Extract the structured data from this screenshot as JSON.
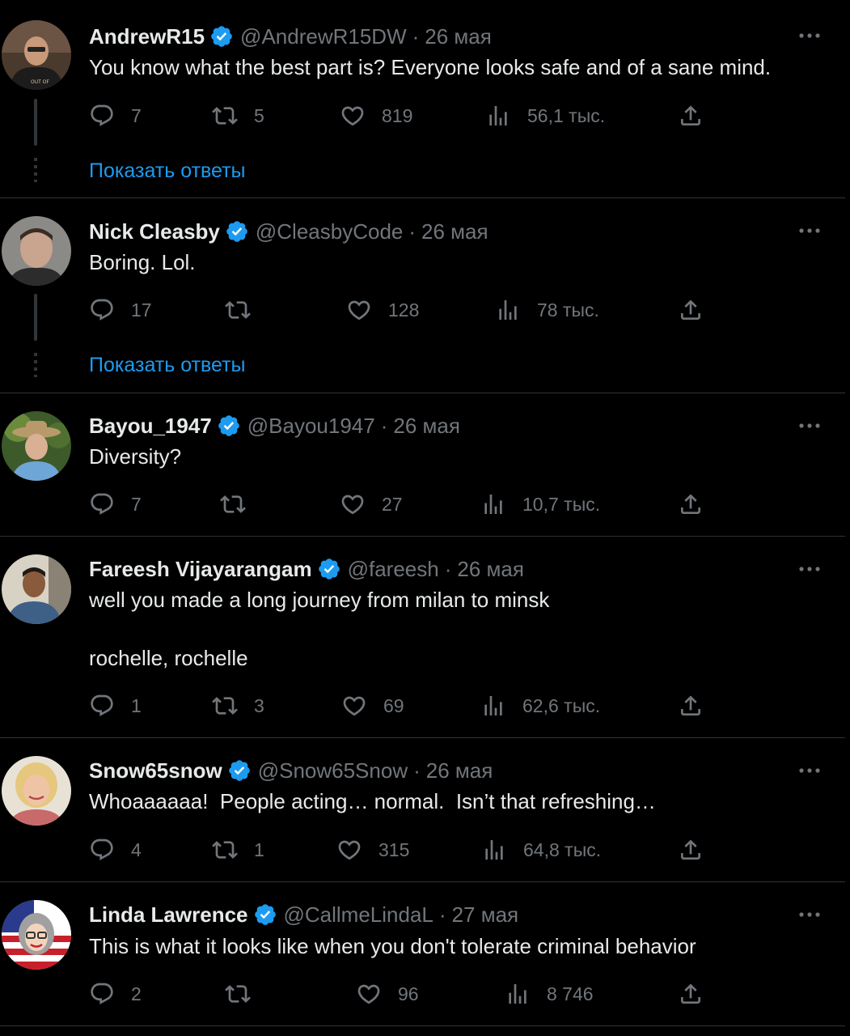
{
  "colors": {
    "background": "#000000",
    "text": "#e7e9ea",
    "secondary": "#71767b",
    "accent": "#1d9bf0",
    "divider": "#2f3336"
  },
  "icons": {
    "reply": "reply-icon",
    "retweet": "retweet-icon",
    "like": "heart-icon",
    "views": "views-chart-icon",
    "share": "share-icon",
    "more": "more-icon",
    "verified": "verified-badge-icon"
  },
  "tweets": [
    {
      "name": "AndrewR15",
      "handle": "@AndrewR15DW",
      "separator": "·",
      "date": "26 мая",
      "text": [
        "You know what the best part is? Everyone looks safe and of a sane mind."
      ],
      "replies": "7",
      "retweets": "5",
      "likes": "819",
      "views": "56,1 тыс.",
      "show_replies": "Показать ответы"
    },
    {
      "name": "Nick Cleasby",
      "handle": "@CleasbyCode",
      "separator": "·",
      "date": "26 мая",
      "text": [
        "Boring. Lol."
      ],
      "replies": "17",
      "retweets": "",
      "likes": "128",
      "views": "78 тыс.",
      "show_replies": "Показать ответы"
    },
    {
      "name": "Bayou_1947",
      "handle": "@Bayou1947",
      "separator": "·",
      "date": "26 мая",
      "text": [
        "Diversity?"
      ],
      "replies": "7",
      "retweets": "",
      "likes": "27",
      "views": "10,7 тыс."
    },
    {
      "name": "Fareesh Vijayarangam",
      "handle": "@fareesh",
      "separator": "·",
      "date": "26 мая",
      "text": [
        "well you made a long journey from milan to minsk",
        "rochelle, rochelle"
      ],
      "replies": "1",
      "retweets": "3",
      "likes": "69",
      "views": "62,6 тыс."
    },
    {
      "name": "Snow65snow",
      "handle": "@Snow65Snow",
      "separator": "·",
      "date": "26 мая",
      "text": [
        "Whoaaaaaa!  People acting… normal.  Isn’t that refreshing…"
      ],
      "replies": "4",
      "retweets": "1",
      "likes": "315",
      "views": "64,8 тыс."
    },
    {
      "name": "Linda Lawrence",
      "handle": "@CallmeLindaL",
      "separator": "·",
      "date": "27 мая",
      "text": [
        "This is what it looks like when you don't tolerate criminal behavior"
      ],
      "replies": "2",
      "retweets": "",
      "likes": "96",
      "views": "8 746"
    }
  ]
}
